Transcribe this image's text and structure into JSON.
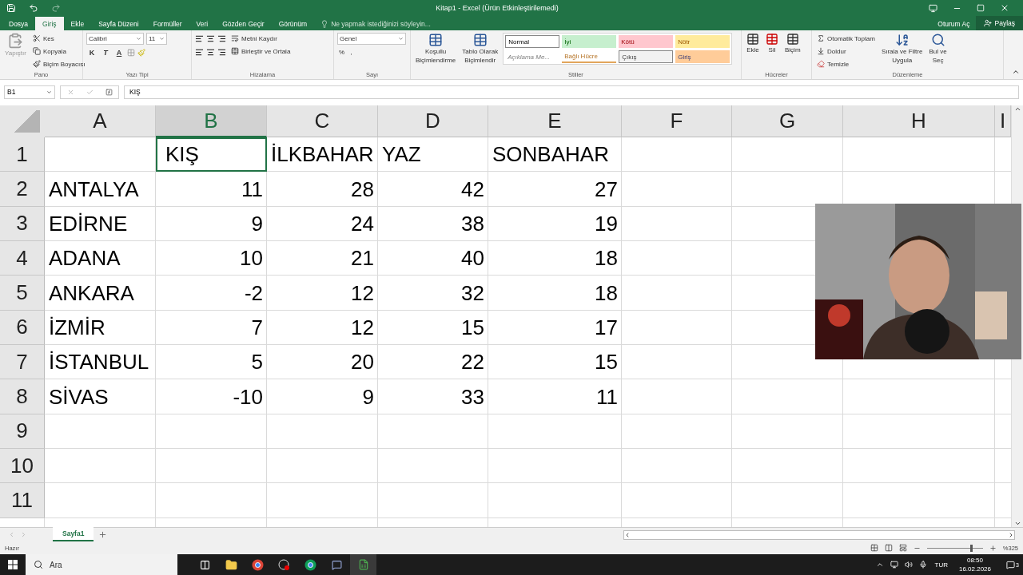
{
  "window": {
    "title": "Kitap1 - Excel (Ürün Etkinleştirilemedi)"
  },
  "ribbon_tabs": [
    {
      "label": "Dosya",
      "selected": false
    },
    {
      "label": "Giriş",
      "selected": true
    },
    {
      "label": "Ekle",
      "selected": false
    },
    {
      "label": "Sayfa Düzeni",
      "selected": false
    },
    {
      "label": "Formüller",
      "selected": false
    },
    {
      "label": "Veri",
      "selected": false
    },
    {
      "label": "Gözden Geçir",
      "selected": false
    },
    {
      "label": "Görünüm",
      "selected": false
    }
  ],
  "tell_me": {
    "placeholder": "Ne yapmak istediğinizi söyleyin..."
  },
  "account": {
    "sign_in": "Oturum Aç",
    "share": "Paylaş"
  },
  "ribbon": {
    "clipboard": {
      "name": "Pano",
      "paste": "Yapıştır",
      "cut": "Kes",
      "copy": "Kopyala",
      "format_painter": "Biçim Boyacısı"
    },
    "font": {
      "name": "Yazı Tipi",
      "font_family": "Calibri",
      "font_size": "11",
      "bold": "K",
      "italic": "T",
      "underline": "A"
    },
    "alignment": {
      "name": "Hizalama",
      "wrap": "Metni Kaydır",
      "merge": "Birleştir ve Ortala"
    },
    "number": {
      "name": "Sayı",
      "format": "Genel",
      "percent": "%",
      "comma": ","
    },
    "styles": {
      "name": "Stiller",
      "conditional": [
        "Koşullu",
        "Biçimlendirme"
      ],
      "as_table": [
        "Tablo Olarak",
        "Biçimlendir"
      ],
      "cell_styles": [
        {
          "label": "Normal",
          "kind": "normal",
          "color": "#ffffff"
        },
        {
          "label": "İyi",
          "kind": "good",
          "color": "#c6efce"
        },
        {
          "label": "Kötü",
          "kind": "bad",
          "color": "#ffc7ce"
        },
        {
          "label": "Nötr",
          "kind": "neutral",
          "color": "#ffeb9c"
        },
        {
          "label": "Açıklama Me...",
          "kind": "note",
          "color": "#ffffff"
        },
        {
          "label": "Bağlı Hücre",
          "kind": "linked",
          "color": "#ffffff"
        },
        {
          "label": "Çıkış",
          "kind": "output",
          "color": "#f2f2f2"
        },
        {
          "label": "Giriş",
          "kind": "input",
          "color": "#ffcc99"
        }
      ]
    },
    "cells": {
      "name": "Hücreler",
      "insert": "Ekle",
      "delete": "Sil",
      "format": "Biçim"
    },
    "editing": {
      "name": "Düzenleme",
      "autosum": "Otomatik Toplam",
      "fill": "Doldur",
      "clear": "Temizle",
      "sort": [
        "Sırala ve Filtre",
        "Uygula"
      ],
      "find": [
        "Bul ve",
        "Seç"
      ]
    }
  },
  "formula_bar": {
    "name_box": "B1",
    "formula": "KIŞ"
  },
  "columns": [
    {
      "label": "A",
      "selected": false
    },
    {
      "label": "B",
      "selected": true
    },
    {
      "label": "C",
      "selected": false
    },
    {
      "label": "D",
      "selected": false
    },
    {
      "label": "E",
      "selected": false
    },
    {
      "label": "F",
      "selected": false
    },
    {
      "label": "G",
      "selected": false
    },
    {
      "label": "H",
      "selected": false
    },
    {
      "label": "I",
      "selected": false
    }
  ],
  "rows": [
    {
      "header": "1",
      "cells": [
        {
          "selected": false
        },
        {
          "value": "KIŞ",
          "kind": "text",
          "selected": true
        },
        {
          "value": "İLKBAHAR",
          "kind": "text",
          "selected": false
        },
        {
          "value": "YAZ",
          "kind": "text",
          "selected": false
        },
        {
          "value": "SONBAHAR",
          "kind": "text",
          "selected": false
        }
      ]
    },
    {
      "header": "2",
      "cells": [
        {
          "value": "ANTALYA",
          "kind": "text",
          "selected": false
        },
        {
          "value": "11",
          "kind": "number",
          "selected": false
        },
        {
          "value": "28",
          "kind": "number",
          "selected": false
        },
        {
          "value": "42",
          "kind": "number",
          "selected": false
        },
        {
          "value": "27",
          "kind": "number",
          "selected": false
        }
      ]
    },
    {
      "header": "3",
      "cells": [
        {
          "value": "EDİRNE",
          "kind": "text",
          "selected": false
        },
        {
          "value": "9",
          "kind": "number",
          "selected": false
        },
        {
          "value": "24",
          "kind": "number",
          "selected": false
        },
        {
          "value": "38",
          "kind": "number",
          "selected": false
        },
        {
          "value": "19",
          "kind": "number",
          "selected": false
        }
      ]
    },
    {
      "header": "4",
      "cells": [
        {
          "value": "ADANA",
          "kind": "text",
          "selected": false
        },
        {
          "value": "10",
          "kind": "number",
          "selected": false
        },
        {
          "value": "21",
          "kind": "number",
          "selected": false
        },
        {
          "value": "40",
          "kind": "number",
          "selected": false
        },
        {
          "value": "18",
          "kind": "number",
          "selected": false
        }
      ]
    },
    {
      "header": "5",
      "cells": [
        {
          "value": "ANKARA",
          "kind": "text",
          "selected": false
        },
        {
          "value": "-2",
          "kind": "number",
          "selected": false
        },
        {
          "value": "12",
          "kind": "number",
          "selected": false
        },
        {
          "value": "32",
          "kind": "number",
          "selected": false
        },
        {
          "value": "18",
          "kind": "number",
          "selected": false
        }
      ]
    },
    {
      "header": "6",
      "cells": [
        {
          "value": "İZMİR",
          "kind": "text",
          "selected": false
        },
        {
          "value": "7",
          "kind": "number",
          "selected": false
        },
        {
          "value": "12",
          "kind": "number",
          "selected": false
        },
        {
          "value": "15",
          "kind": "number",
          "selected": false
        },
        {
          "value": "17",
          "kind": "number",
          "selected": false
        }
      ]
    },
    {
      "header": "7",
      "cells": [
        {
          "value": "İSTANBUL",
          "kind": "text",
          "selected": false
        },
        {
          "value": "5",
          "kind": "number",
          "selected": false
        },
        {
          "value": "20",
          "kind": "number",
          "selected": false
        },
        {
          "value": "22",
          "kind": "number",
          "selected": false
        },
        {
          "value": "15",
          "kind": "number",
          "selected": false
        }
      ]
    },
    {
      "header": "8",
      "cells": [
        {
          "value": "SİVAS",
          "kind": "text",
          "selected": false
        },
        {
          "value": "-10",
          "kind": "number",
          "selected": false
        },
        {
          "value": "9",
          "kind": "number",
          "selected": false
        },
        {
          "value": "33",
          "kind": "number",
          "selected": false
        },
        {
          "value": "11",
          "kind": "number",
          "selected": false
        }
      ]
    },
    {
      "header": "9",
      "cells": []
    },
    {
      "header": "10",
      "cells": []
    },
    {
      "header": "11",
      "cells": []
    }
  ],
  "sheet_tabs": [
    {
      "label": "Sayfa1",
      "selected": true
    }
  ],
  "status_bar": {
    "status": "Hazır",
    "zoom": "%325",
    "zoom_level": {
      "level": 0.82
    }
  },
  "taskbar": {
    "search": {
      "placeholder": "Ara"
    },
    "language": "TUR",
    "time": "08:50",
    "date": "16.02.2026",
    "notifications": "3"
  }
}
